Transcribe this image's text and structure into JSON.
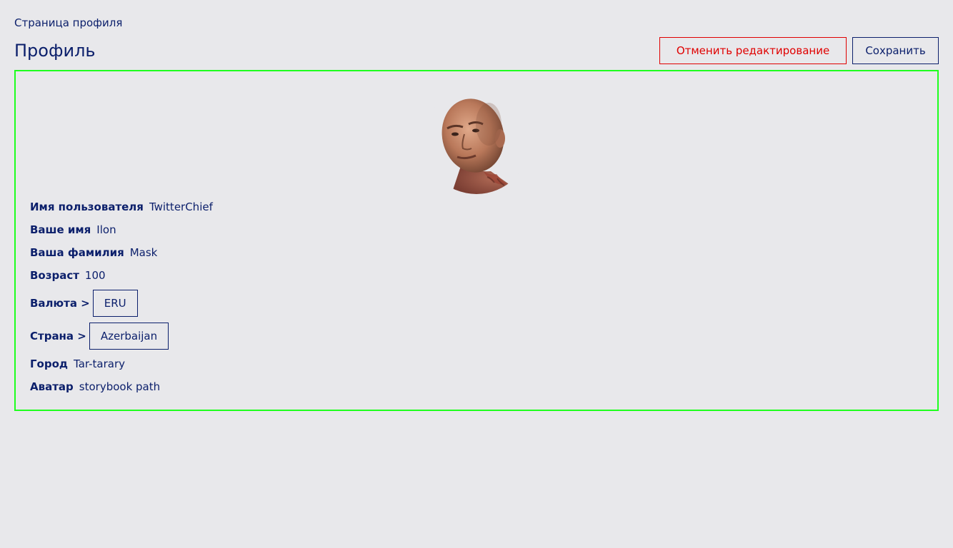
{
  "breadcrumb": "Страница профиля",
  "header": {
    "title": "Профиль",
    "cancel_label": "Отменить редактирование",
    "save_label": "Сохранить"
  },
  "colors": {
    "text": "#0b1f6b",
    "danger": "#e00000",
    "card_border": "#1eff1e",
    "background": "#e8e8eb"
  },
  "profile": {
    "avatar_icon": "user-avatar-photo",
    "username": {
      "label": "Имя пользователя",
      "value": "TwitterChief"
    },
    "first_name": {
      "label": "Ваше имя",
      "value": "Ilon"
    },
    "last_name": {
      "label": "Ваша фамилия",
      "value": "Mask"
    },
    "age": {
      "label": "Возраст",
      "value": "100"
    },
    "currency": {
      "label": "Валюта >",
      "value": "ERU"
    },
    "country": {
      "label": "Страна >",
      "value": "Azerbaijan"
    },
    "city": {
      "label": "Город",
      "value": "Tar-tarary"
    },
    "avatar": {
      "label": "Аватар",
      "value": "storybook path"
    }
  }
}
